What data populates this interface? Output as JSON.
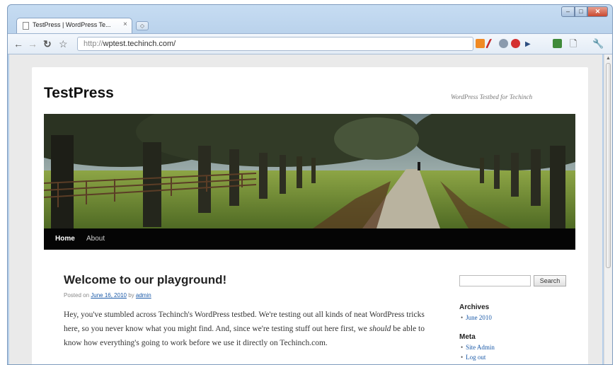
{
  "browser": {
    "tab_title": "TestPress | WordPress Te...",
    "tab_close": "×",
    "url_protocol": "http://",
    "url_host": "wptest.techinch.com/"
  },
  "site": {
    "title": "TestPress",
    "description": "WordPress Testbed for Techinch"
  },
  "menu": {
    "items": [
      "Home",
      "About"
    ]
  },
  "post": {
    "title": "Welcome to our playground!",
    "posted_on_label": "Posted on",
    "date": "June 16, 2010",
    "by_label": "by",
    "author": "admin",
    "body_before": "Hey, you've stumbled across Techinch's WordPress testbed.  We're testing out all kinds of neat WordPress tricks here, so you never know what you might find.  And, since we're testing stuff out here first, we ",
    "body_emph": "should",
    "body_after": " be able to know how everything's going to work before we use it directly on Techinch.com."
  },
  "sidebar": {
    "search_button": "Search",
    "archives_title": "Archives",
    "archives_items": [
      "June 2010"
    ],
    "meta_title": "Meta",
    "meta_items": [
      "Site Admin",
      "Log out"
    ]
  },
  "colors": {
    "menu_bg": "#050505",
    "link": "#1b5aa8",
    "chrome_frame": "#b7d0ea"
  }
}
